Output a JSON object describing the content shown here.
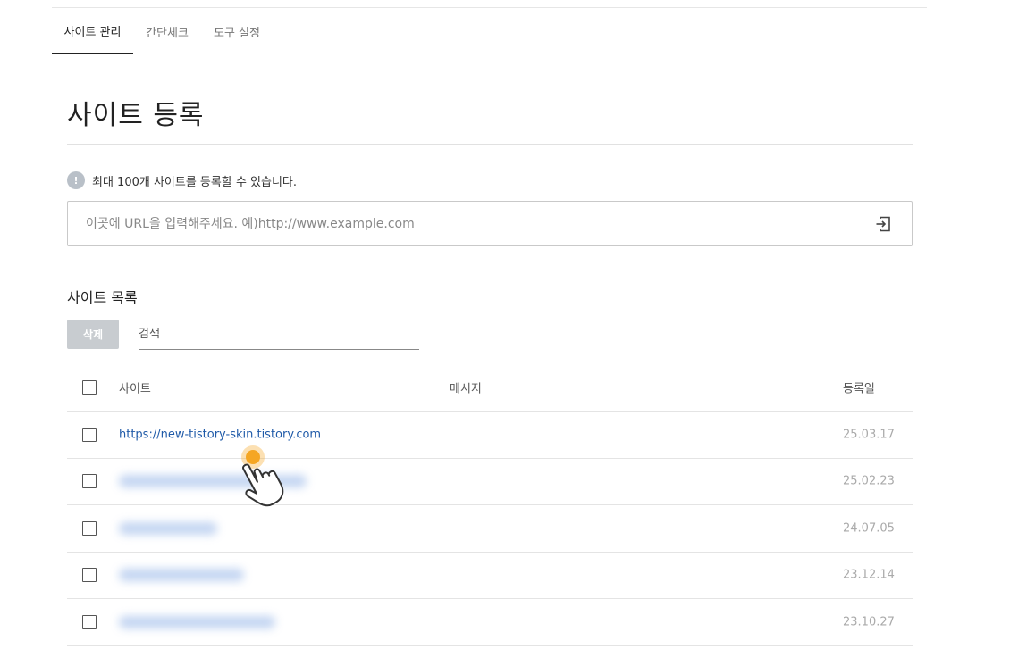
{
  "tabs": [
    "사이트 관리",
    "간단체크",
    "도구 설정"
  ],
  "page_title": "사이트 등록",
  "notice": {
    "icon": "info-icon",
    "text": "최대 100개 사이트를 등록할 수 있습니다."
  },
  "url_input": {
    "placeholder": "이곳에 URL을 입력해주세요. 예)http://www.example.com",
    "value": "",
    "submit_icon": "sign-in-icon"
  },
  "site_list": {
    "title": "사이트 목록",
    "delete_label": "삭제",
    "search_placeholder": "검색",
    "columns": {
      "site": "사이트",
      "message": "메시지",
      "date": "등록일"
    },
    "rows": [
      {
        "site": "https://new-tistory-skin.tistory.com",
        "message": "",
        "date": "25.03.17",
        "blurred": false
      },
      {
        "site": "",
        "message": "",
        "date": "25.02.23",
        "blurred": true
      },
      {
        "site": "",
        "message": "",
        "date": "24.07.05",
        "blurred": true
      },
      {
        "site": "",
        "message": "",
        "date": "23.12.14",
        "blurred": true
      },
      {
        "site": "",
        "message": "",
        "date": "23.10.27",
        "blurred": true
      }
    ]
  },
  "colors": {
    "link": "#1f5aa8",
    "delete_button_bg": "#c8ccd0",
    "cursor_highlight": "#f5a623"
  }
}
